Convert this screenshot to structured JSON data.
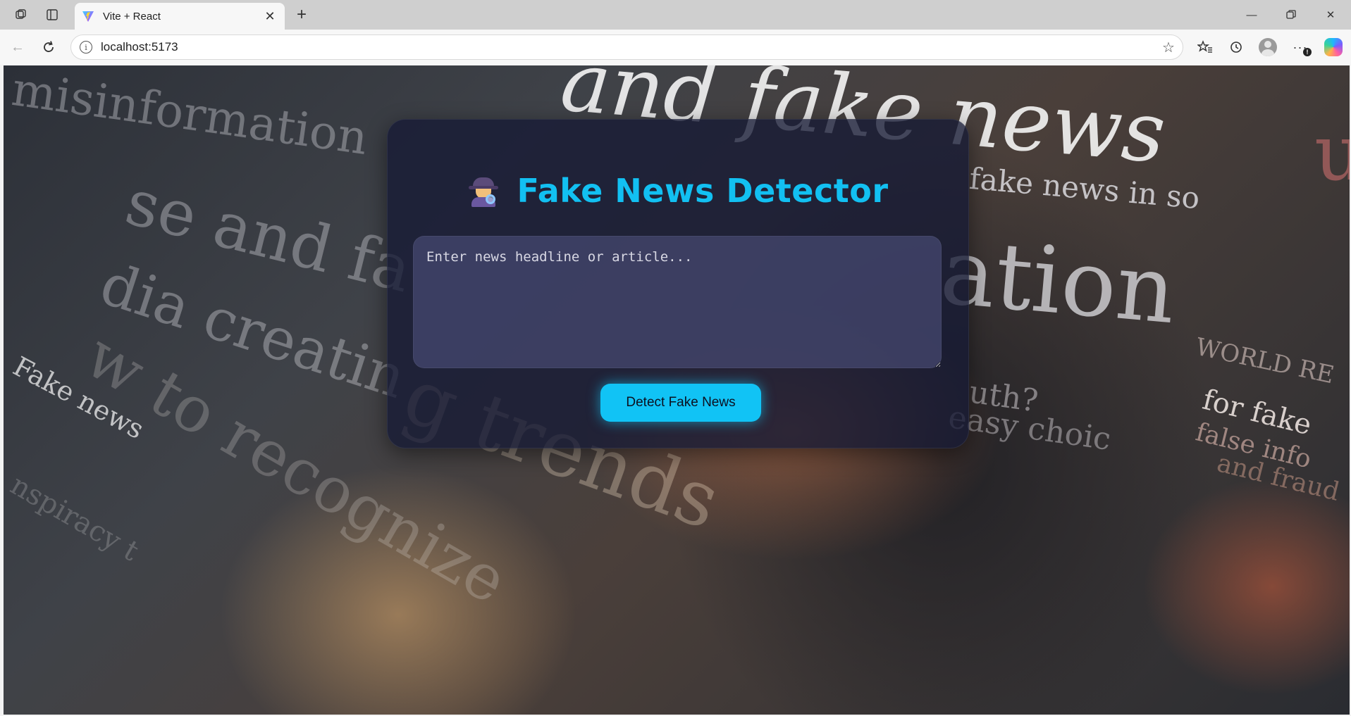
{
  "browser": {
    "tab": {
      "title": "Vite + React"
    },
    "address": {
      "url": "localhost:5173"
    },
    "profile_badge": "!"
  },
  "background_text": {
    "w1": "and fake news",
    "w2": "misinformation",
    "w3": "se and fa",
    "w4": "dia creatin",
    "w5": "fake news in so",
    "w6": "ation",
    "w7": "g trends",
    "w8": "Fake news",
    "w9": "w to recognize",
    "w10": "WORLD RE",
    "w11": "for fake",
    "w12": "false info",
    "w13": "and fraud",
    "w14": "uth?",
    "w15": "easy choic",
    "w16": "nspiracy t",
    "w17": "u"
  },
  "app": {
    "title": "Fake News Detector",
    "input": {
      "placeholder": "Enter news headline or article...",
      "value": ""
    },
    "detect_button": "Detect Fake News"
  },
  "colors": {
    "accent": "#11c3f5",
    "card": "#161a34"
  }
}
